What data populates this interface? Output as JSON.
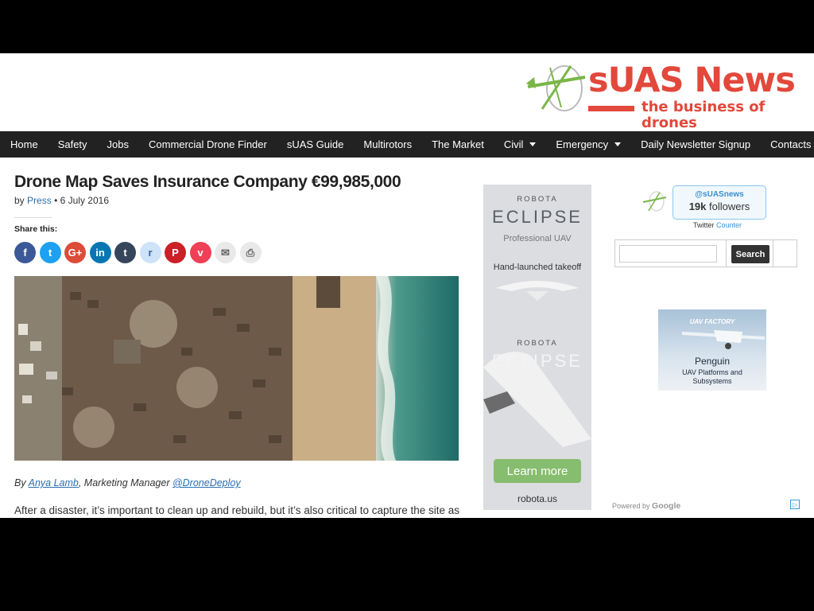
{
  "header": {
    "logo_title": "sUAS News",
    "logo_tagline": "the business of drones"
  },
  "nav": {
    "items": [
      {
        "label": "Home",
        "dropdown": false
      },
      {
        "label": "Safety",
        "dropdown": false
      },
      {
        "label": "Jobs",
        "dropdown": false
      },
      {
        "label": "Commercial Drone Finder",
        "dropdown": false
      },
      {
        "label": "sUAS Guide",
        "dropdown": false
      },
      {
        "label": "Multirotors",
        "dropdown": false
      },
      {
        "label": "The Market",
        "dropdown": false
      },
      {
        "label": "Civil",
        "dropdown": true
      },
      {
        "label": "Emergency",
        "dropdown": true
      },
      {
        "label": "Daily Newsletter Signup",
        "dropdown": false
      },
      {
        "label": "Contacts",
        "dropdown": true
      }
    ]
  },
  "article": {
    "title": "Drone Map Saves Insurance Company €99,985,000",
    "by": "by",
    "author": "Press",
    "separator": "•",
    "date": "6 July 2016",
    "share_label": "Share this:",
    "share_buttons": [
      {
        "name": "facebook",
        "glyph": "f",
        "color": "#3b5998"
      },
      {
        "name": "twitter",
        "glyph": "t",
        "color": "#1da1f2"
      },
      {
        "name": "google-plus",
        "glyph": "G+",
        "color": "#dd4b39"
      },
      {
        "name": "linkedin",
        "glyph": "in",
        "color": "#0976b4"
      },
      {
        "name": "tumblr",
        "glyph": "t",
        "color": "#35465c"
      },
      {
        "name": "reddit",
        "glyph": "r",
        "color": "#cee3f8"
      },
      {
        "name": "pinterest",
        "glyph": "P",
        "color": "#cb2027"
      },
      {
        "name": "pocket",
        "glyph": "v",
        "color": "#ee4056"
      },
      {
        "name": "email",
        "glyph": "✉",
        "color": "#e9e9e9"
      },
      {
        "name": "print",
        "glyph": "⎙",
        "color": "#e9e9e9"
      }
    ],
    "credit_prefix": "By",
    "credit_author": "Anya Lamb",
    "credit_role": ", Marketing Manager",
    "credit_handle": "@DroneDeploy",
    "body_first_line": "After a disaster, it’s important to clean up and rebuild, but it’s also critical to capture the site as"
  },
  "robota_ad": {
    "brand_top": "ROBOTA",
    "product_top": "ECLIPSE",
    "subtitle": "Professional UAV",
    "feature": "Hand-launched takeoff",
    "brand_mid": "ROBOTA",
    "product_mid": "ECLIPSE",
    "cta": "Learn more",
    "url": "robota.us"
  },
  "twitter": {
    "handle": "@sUASnews",
    "count": "19k",
    "followers_label": "followers",
    "footer_left": "Twitter",
    "footer_right": "Counter"
  },
  "search": {
    "value": "",
    "button_label": "Search"
  },
  "penguin_ad": {
    "brand": "UAV FACTORY",
    "title": "Penguin",
    "line1": "UAV Platforms and",
    "line2": "Subsystems"
  },
  "powered_by": {
    "prefix": "Powered by",
    "brand": "Google"
  },
  "colors": {
    "brand_red": "#e2483b",
    "nav_bg": "#222222",
    "link_blue": "#2a6fb0"
  }
}
